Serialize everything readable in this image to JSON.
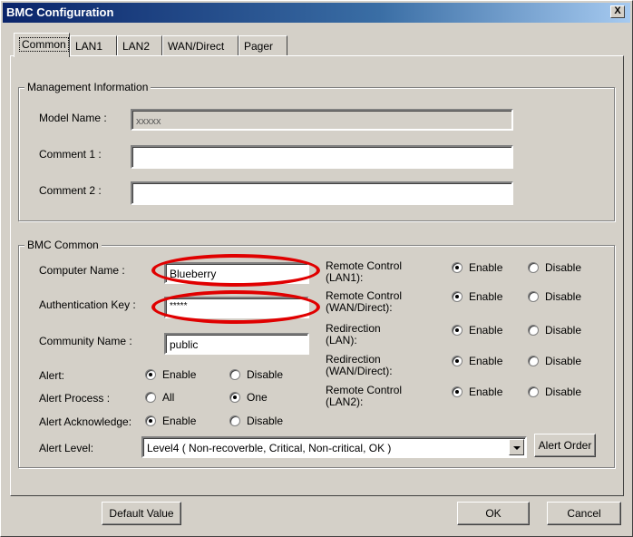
{
  "window": {
    "title": "BMC Configuration",
    "close_label": "X"
  },
  "tabs": [
    "Common",
    "LAN1",
    "LAN2",
    "WAN/Direct",
    "Pager"
  ],
  "management": {
    "legend": "Management Information",
    "model_name_label": "Model Name :",
    "model_name_value": "xxxxx",
    "comment1_label": "Comment 1 :",
    "comment1_value": "",
    "comment2_label": "Comment 2 :",
    "comment2_value": ""
  },
  "bmc": {
    "legend": "BMC Common",
    "computer_name_label": "Computer Name :",
    "computer_name_value": "Blueberry",
    "auth_key_label": "Authentication Key :",
    "auth_key_value": "*****",
    "community_name_label": "Community Name :",
    "community_name_value": "public",
    "alert_label": "Alert:",
    "alert_enable": "Enable",
    "alert_disable": "Disable",
    "alert_process_label": "Alert Process :",
    "alert_process_all": "All",
    "alert_process_one": "One",
    "alert_ack_label": "Alert Acknowledge:",
    "alert_ack_enable": "Enable",
    "alert_ack_disable": "Disable",
    "alert_level_label": "Alert Level:",
    "alert_level_value": "Level4 ( Non-recoverble, Critical, Non-critical, OK )",
    "alert_order_label": "Alert Order",
    "remote_rows": [
      {
        "line1": "Remote Control",
        "line2": "(LAN1):",
        "enable": "Enable",
        "disable": "Disable"
      },
      {
        "line1": "Remote Control",
        "line2": "(WAN/Direct):",
        "enable": "Enable",
        "disable": "Disable"
      },
      {
        "line1": "Redirection",
        "line2": "(LAN):",
        "enable": "Enable",
        "disable": "Disable"
      },
      {
        "line1": "Redirection",
        "line2": "(WAN/Direct):",
        "enable": "Enable",
        "disable": "Disable"
      },
      {
        "line1": "Remote Control",
        "line2": "(LAN2):",
        "enable": "Enable",
        "disable": "Disable"
      }
    ]
  },
  "footer": {
    "default_value_label": "Default Value",
    "ok_label": "OK",
    "cancel_label": "Cancel"
  },
  "colors": {
    "highlight_ellipse": "#e00000",
    "titlebar_start": "#0a246a",
    "face": "#d4d0c8"
  }
}
